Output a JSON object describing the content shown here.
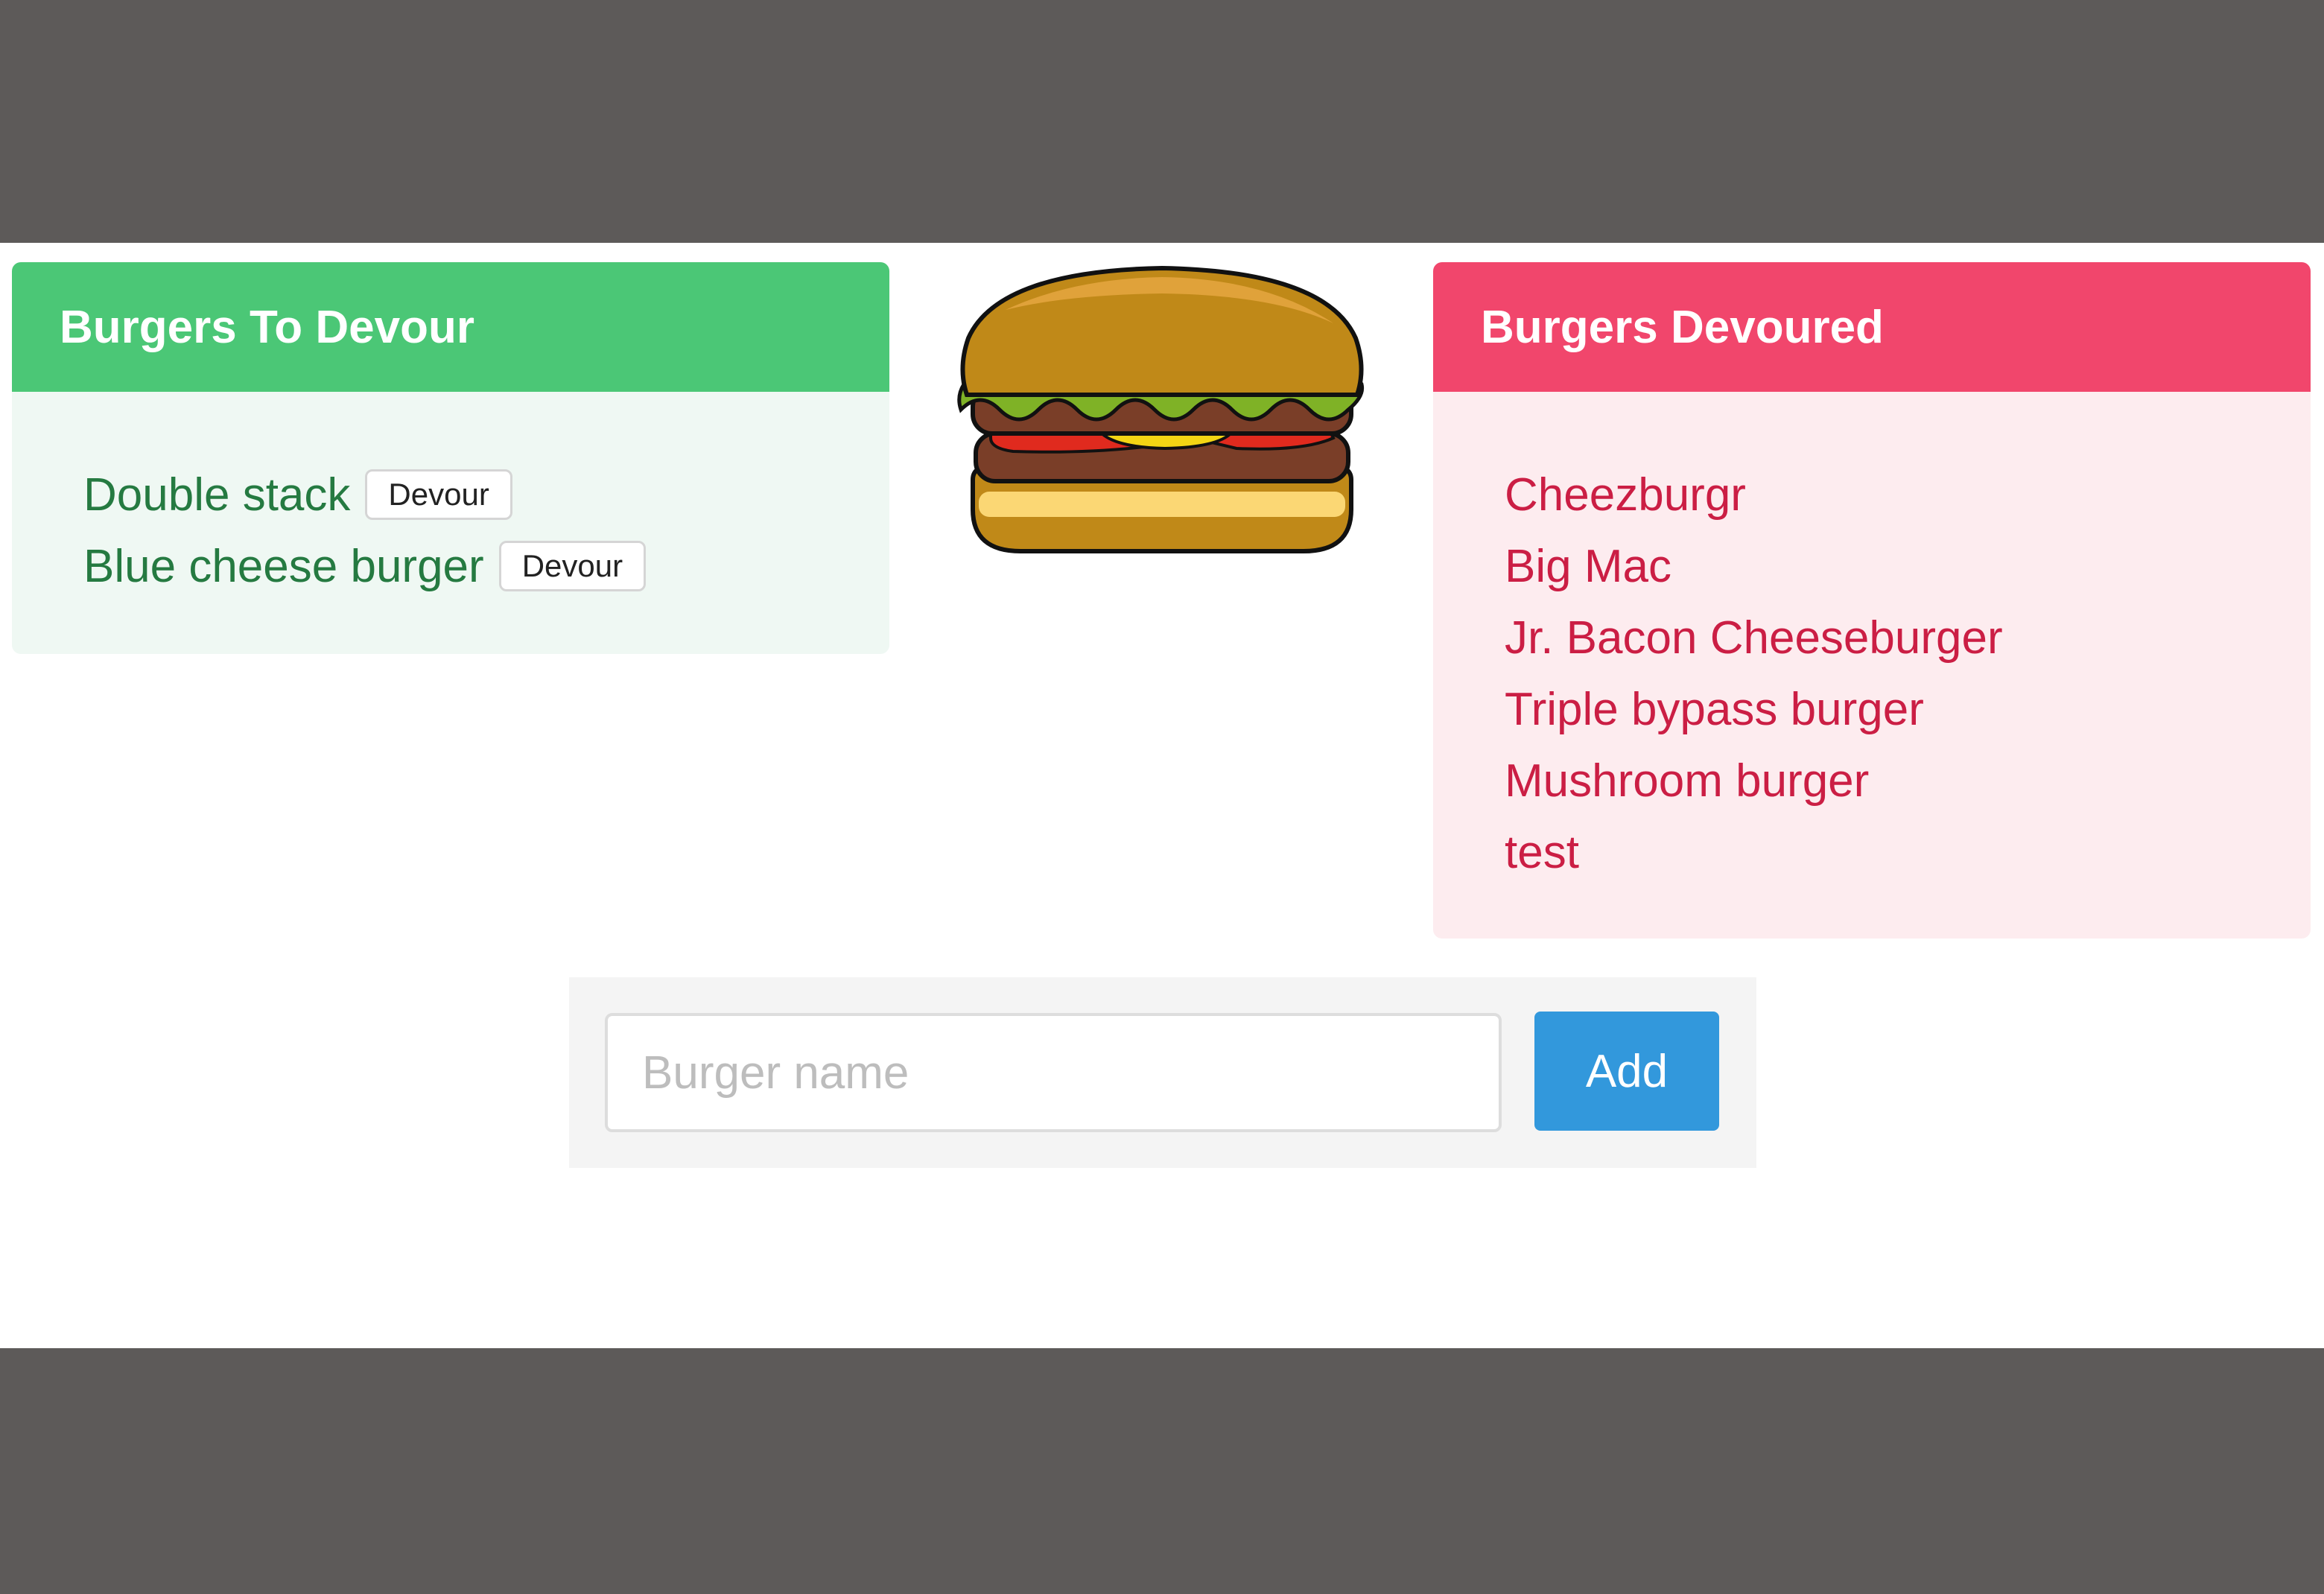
{
  "todo": {
    "title": "Burgers To Devour",
    "items": [
      {
        "name": "Double stack",
        "button": "Devour"
      },
      {
        "name": "Blue cheese burger",
        "button": "Devour"
      }
    ]
  },
  "devoured": {
    "title": "Burgers Devoured",
    "items": [
      "Cheezburgr",
      "Big Mac",
      "Jr. Bacon Cheeseburger",
      "Triple bypass burger",
      "Mushroom burger",
      "test"
    ]
  },
  "form": {
    "placeholder": "Burger name",
    "value": "",
    "button": "Add"
  },
  "colors": {
    "todo_header": "#4bc776",
    "todo_body": "#eff8f3",
    "todo_text": "#257a41",
    "done_header": "#f1466c",
    "done_body": "#fdecef",
    "done_text": "#cb1e44",
    "add_button": "#3298dc"
  },
  "icons": {
    "hero": "hamburger-icon"
  }
}
